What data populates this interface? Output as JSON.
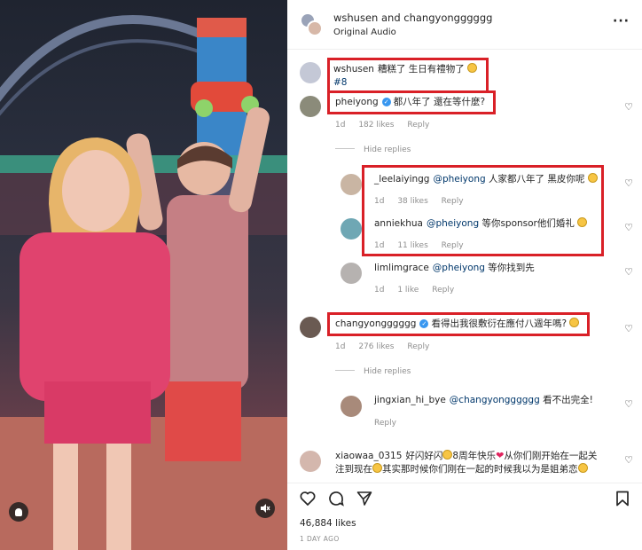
{
  "header": {
    "title": "wshusen and changyongggggg",
    "subtitle": "Original Audio",
    "more": "···"
  },
  "caption": {
    "username": "wshusen",
    "text": "糟糕了 生日有禮物了",
    "line2": "#8"
  },
  "comments": [
    {
      "username": "pheiyong",
      "verified": true,
      "text": "都八年了 還在等什麼?",
      "time": "1d",
      "likes": "182 likes",
      "reply": "Reply",
      "hide": "Hide replies"
    },
    {
      "username": "_leelaiyingg",
      "mention": "@pheiyong",
      "text": "人家都八年了 黑皮你呢",
      "time": "1d",
      "likes": "38 likes",
      "reply": "Reply"
    },
    {
      "username": "anniekhua",
      "mention": "@pheiyong",
      "text": "等你sponsor他们婚礼",
      "time": "1d",
      "likes": "11 likes",
      "reply": "Reply"
    },
    {
      "username": "limlimgrace",
      "mention": "@pheiyong",
      "text": "等你找到先",
      "time": "1d",
      "likes": "1 like",
      "reply": "Reply"
    },
    {
      "username": "changyongggggg",
      "verified": true,
      "text": "看得出我很敷衍在應付八週年嗎?",
      "time": "1d",
      "likes": "276 likes",
      "reply": "Reply",
      "hide": "Hide replies"
    },
    {
      "username": "jingxian_hi_bye",
      "mention": "@changyongggggg",
      "text": "看不出完全!",
      "time": "1d",
      "reply": "Reply"
    },
    {
      "username": "xiaowaa_0315",
      "text": "好闪好闪",
      "text2": "8周年快乐",
      "text3": "从你们刚开始在一起关",
      "line2a": "注到现在",
      "line2b": "其实那时候你们刚在一起的时候我以为是姐弟恋"
    }
  ],
  "footer": {
    "likes": "46,884 likes",
    "ago": "1 DAY AGO"
  },
  "icons": [
    "heart-icon",
    "comment-icon",
    "share-icon",
    "bookmark-icon",
    "user-icon",
    "mute-icon",
    "more-icon"
  ],
  "colors": {
    "highlight": "#d92027",
    "verified": "#3897f0",
    "link": "#00376b"
  }
}
